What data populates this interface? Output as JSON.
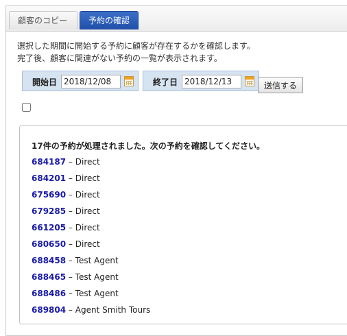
{
  "tabs": [
    {
      "label": "顧客のコピー",
      "active": false
    },
    {
      "label": "予約の確認",
      "active": true
    }
  ],
  "description": {
    "line1": "選択した期間に開始する予約に顧客が存在するかを確認します。",
    "line2": "完了後、顧客に関連がない予約の一覧が表示されます。"
  },
  "form": {
    "start_label": "開始日",
    "start_value": "2018/12/08",
    "end_label": "終了日",
    "end_value": "2018/12/13",
    "submit_label": "送信する",
    "checkbox_checked": false
  },
  "results": {
    "summary": "17件の予約が処理されました。次の予約を確認してください。",
    "items": [
      {
        "id": "684187",
        "agent": " – Direct"
      },
      {
        "id": "684201",
        "agent": " – Direct"
      },
      {
        "id": "675690",
        "agent": " – Direct"
      },
      {
        "id": "679285",
        "agent": " – Direct"
      },
      {
        "id": "661205",
        "agent": " – Direct"
      },
      {
        "id": "680650",
        "agent": " – Direct"
      },
      {
        "id": "688458",
        "agent": " – Test Agent"
      },
      {
        "id": "688465",
        "agent": " – Test Agent"
      },
      {
        "id": "688486",
        "agent": " – Test Agent"
      },
      {
        "id": "689804",
        "agent": " – Agent Smith Tours"
      }
    ]
  },
  "colors": {
    "active_tab": "#2a5bb8",
    "date_box": "#d6e3f1",
    "link": "#1a1aa8"
  },
  "icons": {
    "date_picker": "calendar-icon"
  }
}
